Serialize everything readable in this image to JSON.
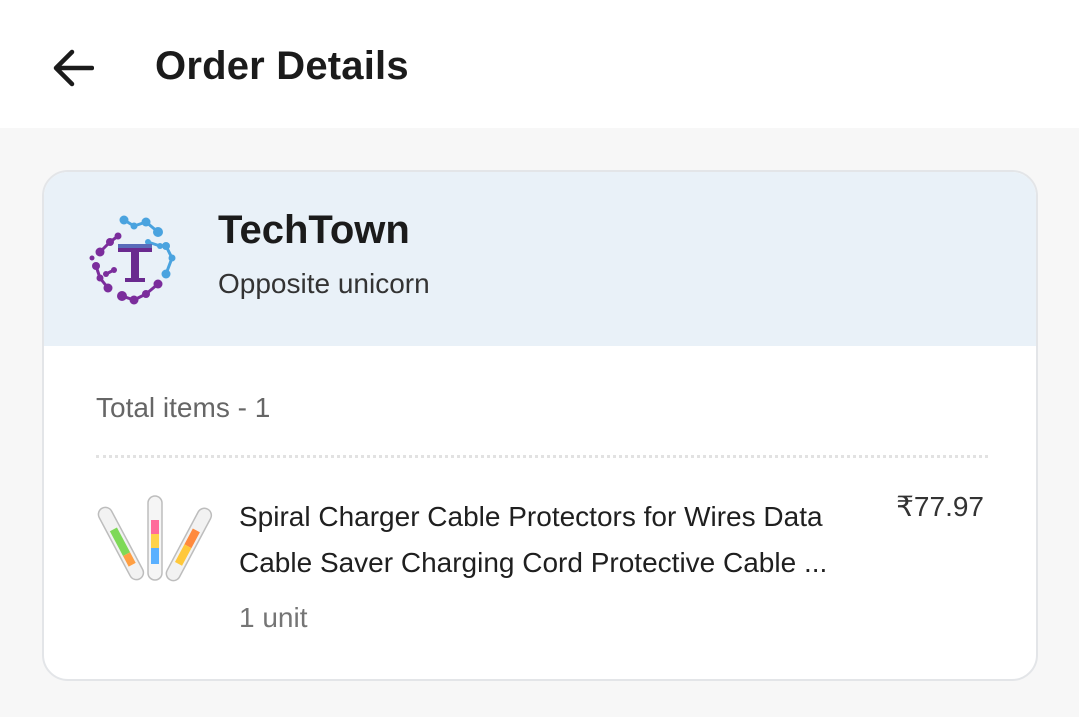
{
  "header": {
    "title": "Order Details",
    "back_icon": "arrow-left-icon"
  },
  "store": {
    "name": "TechTown",
    "address": "Opposite unicorn",
    "logo_letter": "T",
    "logo_colors": {
      "purple": "#7b2d9c",
      "blue": "#4aa3df"
    }
  },
  "order": {
    "total_items_label": "Total items - 1",
    "items": [
      {
        "name_line1": "Spiral Charger Cable Protectors for Wires Data",
        "name_line2": "Cable Saver Charging Cord Protective Cable ...",
        "price": "₹77.97",
        "quantity": "1 unit"
      }
    ]
  },
  "colors": {
    "header_bg": "#e9f1f8",
    "page_bg": "#f7f7f7"
  }
}
